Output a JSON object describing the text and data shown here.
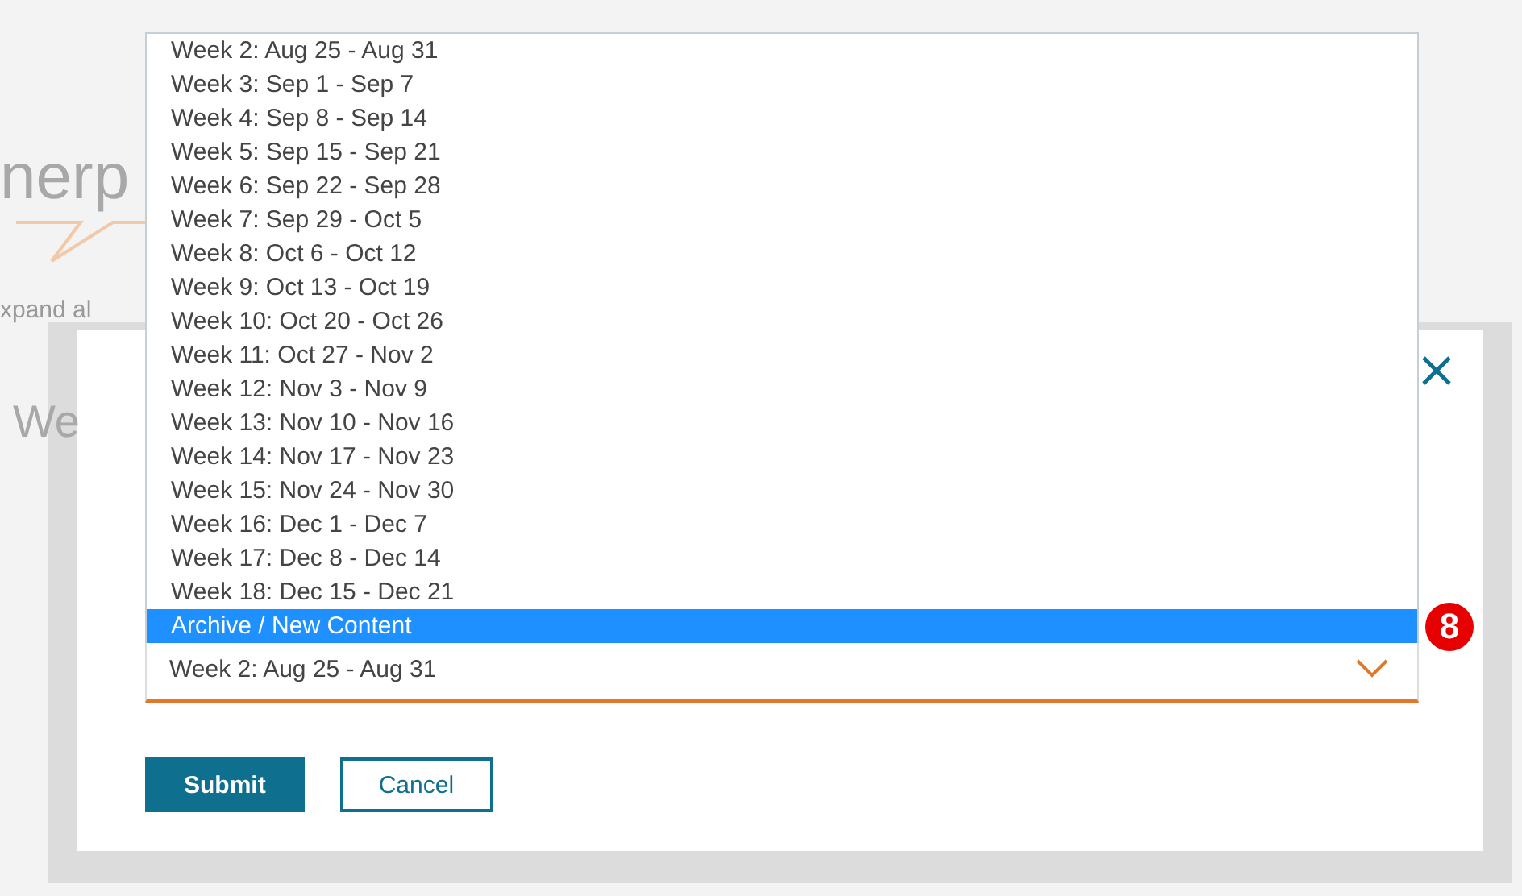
{
  "background_page": {
    "title_fragment": "nerp",
    "link_fragment": "xpand al",
    "heading_fragment": "We"
  },
  "dialog": {
    "select": {
      "value": "Week 2: Aug 25 - Aug 31",
      "expanded": true,
      "options": [
        {
          "label": "Week 2: Aug 25 - Aug 31",
          "highlighted": false
        },
        {
          "label": "Week 3: Sep 1 - Sep 7",
          "highlighted": false
        },
        {
          "label": "Week 4: Sep 8 - Sep 14",
          "highlighted": false
        },
        {
          "label": "Week 5: Sep 15 - Sep 21",
          "highlighted": false
        },
        {
          "label": "Week 6: Sep 22 - Sep 28",
          "highlighted": false
        },
        {
          "label": "Week 7: Sep 29 - Oct 5",
          "highlighted": false
        },
        {
          "label": "Week 8: Oct 6 - Oct 12",
          "highlighted": false
        },
        {
          "label": "Week 9: Oct 13 - Oct 19",
          "highlighted": false
        },
        {
          "label": "Week 10: Oct 20 - Oct 26",
          "highlighted": false
        },
        {
          "label": "Week 11: Oct 27 - Nov 2",
          "highlighted": false
        },
        {
          "label": "Week 12: Nov 3 - Nov 9",
          "highlighted": false
        },
        {
          "label": "Week 13: Nov 10 - Nov 16",
          "highlighted": false
        },
        {
          "label": "Week 14: Nov 17 - Nov 23",
          "highlighted": false
        },
        {
          "label": "Week 15: Nov 24 - Nov 30",
          "highlighted": false
        },
        {
          "label": "Week 16: Dec 1 - Dec 7",
          "highlighted": false
        },
        {
          "label": "Week 17: Dec 8 - Dec 14",
          "highlighted": false
        },
        {
          "label": "Week 18: Dec 15 - Dec 21",
          "highlighted": false
        },
        {
          "label": "Archive / New Content",
          "highlighted": true
        }
      ]
    },
    "badge": "8",
    "buttons": [
      {
        "label": "Submit",
        "kind": "primary"
      },
      {
        "label": "Cancel",
        "kind": "secondary"
      }
    ]
  }
}
